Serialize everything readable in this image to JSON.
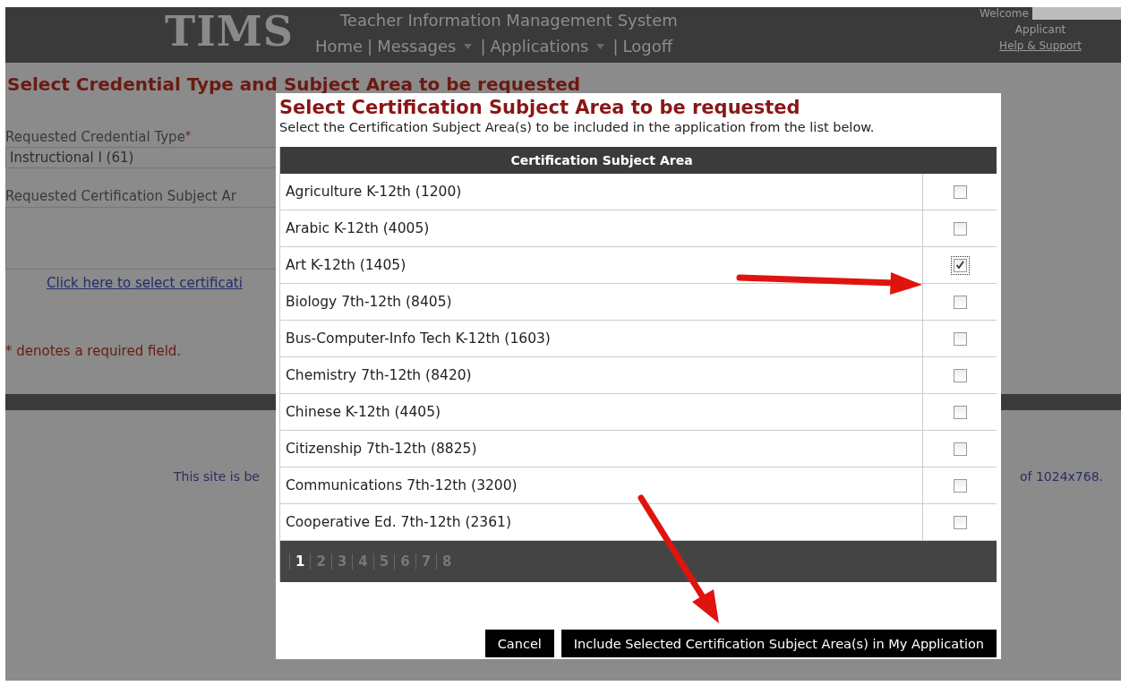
{
  "header": {
    "logo": "TIMS",
    "title": "Teacher Information Management System",
    "nav": [
      {
        "label": "Home",
        "dropdown": false
      },
      {
        "label": "Messages",
        "dropdown": true
      },
      {
        "label": "Applications",
        "dropdown": true
      },
      {
        "label": "Logoff",
        "dropdown": false
      }
    ],
    "separator": "|",
    "welcome": "Welcome",
    "role": "Applicant",
    "help_link": "Help & Support"
  },
  "page": {
    "heading": "Select Credential Type and Subject Area to be requested",
    "credential_label": "Requested Credential Type",
    "required_mark": "*",
    "credential_value": "Instructional I (61)",
    "subject_label": "Requested Certification Subject Ar",
    "select_link": "Click here to select certificati",
    "required_note": "* denotes a required field.",
    "footer_left": "This site is be",
    "footer_right": "of 1024x768."
  },
  "dialog": {
    "title": "Select Certification Subject Area to be requested",
    "subtitle": "Select the Certification Subject Area(s) to be included in the application from the list below.",
    "column": "Certification Subject Area",
    "rows": [
      {
        "name": "Agriculture K-12th (1200)",
        "checked": false
      },
      {
        "name": "Arabic K-12th (4005)",
        "checked": false
      },
      {
        "name": "Art K-12th (1405)",
        "checked": true
      },
      {
        "name": "Biology 7th-12th (8405)",
        "checked": false
      },
      {
        "name": "Bus-Computer-Info Tech K-12th (1603)",
        "checked": false
      },
      {
        "name": "Chemistry 7th-12th (8420)",
        "checked": false
      },
      {
        "name": "Chinese K-12th (4405)",
        "checked": false
      },
      {
        "name": "Citizenship 7th-12th (8825)",
        "checked": false
      },
      {
        "name": "Communications 7th-12th (3200)",
        "checked": false
      },
      {
        "name": "Cooperative Ed. 7th-12th (2361)",
        "checked": false
      }
    ],
    "pages": [
      {
        "label": "1",
        "selected": true
      },
      {
        "label": "2",
        "selected": false
      },
      {
        "label": "3",
        "selected": false
      },
      {
        "label": "4",
        "selected": false
      },
      {
        "label": "5",
        "selected": false
      },
      {
        "label": "6",
        "selected": false
      },
      {
        "label": "7",
        "selected": false
      },
      {
        "label": "8",
        "selected": false
      }
    ],
    "buttons": [
      "Cancel",
      "Include Selected Certification Subject Area(s) in My Application"
    ]
  }
}
